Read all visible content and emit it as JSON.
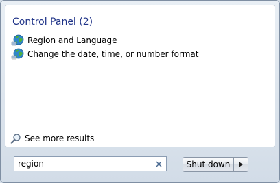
{
  "results": {
    "group_title": "Control Panel (2)",
    "items": [
      {
        "label": "Region and Language",
        "icon": "globe-icon"
      },
      {
        "label": "Change the date, time, or number format",
        "icon": "globe-icon"
      }
    ],
    "see_more": {
      "label": "See more results",
      "icon": "magnifier-icon"
    }
  },
  "search": {
    "value": "region",
    "clear_icon": "clear-x-icon"
  },
  "power": {
    "button_label": "Shut down",
    "arrow_icon": "triangle-right-icon"
  },
  "colors": {
    "group_title": "#1e3287",
    "panel_background": "#ffffff",
    "frame": "#d2dce7"
  }
}
